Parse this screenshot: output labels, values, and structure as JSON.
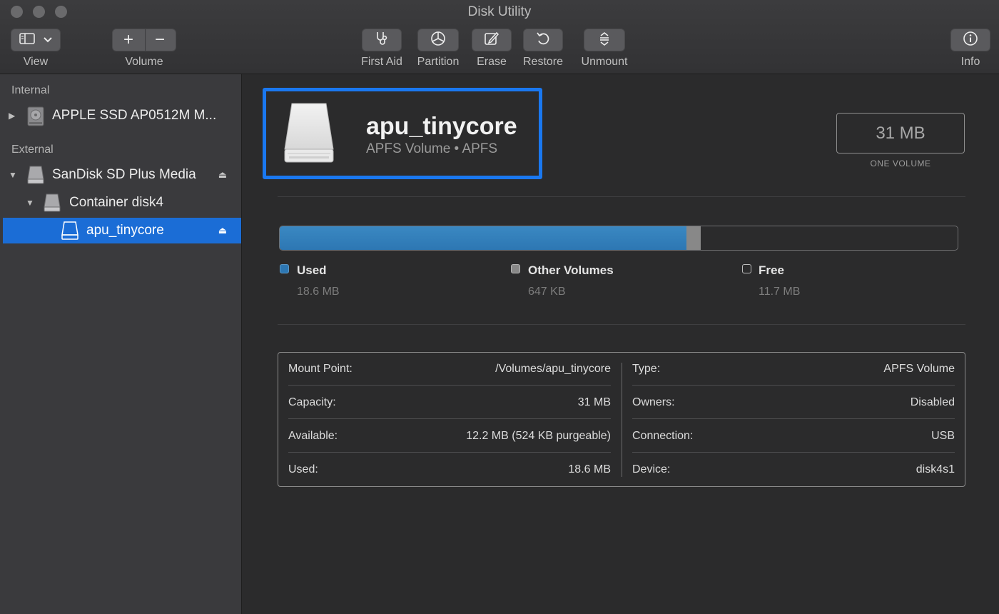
{
  "window": {
    "title": "Disk Utility"
  },
  "toolbar": {
    "view_label": "View",
    "volume_label": "Volume",
    "first_aid_label": "First Aid",
    "partition_label": "Partition",
    "erase_label": "Erase",
    "restore_label": "Restore",
    "unmount_label": "Unmount",
    "info_label": "Info",
    "add_symbol": "+",
    "remove_symbol": "−"
  },
  "sidebar": {
    "internal_header": "Internal",
    "external_header": "External",
    "items": [
      {
        "label": "APPLE SSD AP0512M M...",
        "icon": "internal-disk-icon",
        "expanded": false
      },
      {
        "label": "SanDisk SD Plus Media",
        "icon": "external-disk-icon",
        "expanded": true
      },
      {
        "label": "Container disk4",
        "icon": "container-disk-icon",
        "expanded": true
      },
      {
        "label": "apu_tinycore",
        "icon": "volume-icon",
        "selected": true
      }
    ]
  },
  "volume": {
    "name": "apu_tinycore",
    "subtitle": "APFS Volume • APFS",
    "capacity": "31 MB",
    "capacity_caption": "ONE VOLUME"
  },
  "usage": {
    "used_fraction": 0.6,
    "other_fraction": 0.021,
    "legend": [
      {
        "name": "Used",
        "value": "18.6 MB",
        "color": "#2d77b3"
      },
      {
        "name": "Other Volumes",
        "value": "647 KB",
        "color": "#888888"
      },
      {
        "name": "Free",
        "value": "11.7 MB",
        "color": "#2b2b2c"
      }
    ]
  },
  "info": {
    "left": [
      {
        "key": "Mount Point:",
        "value": "/Volumes/apu_tinycore"
      },
      {
        "key": "Capacity:",
        "value": "31 MB"
      },
      {
        "key": "Available:",
        "value": "12.2 MB (524 KB purgeable)"
      },
      {
        "key": "Used:",
        "value": "18.6 MB"
      }
    ],
    "right": [
      {
        "key": "Type:",
        "value": "APFS Volume"
      },
      {
        "key": "Owners:",
        "value": "Disabled"
      },
      {
        "key": "Connection:",
        "value": "USB"
      },
      {
        "key": "Device:",
        "value": "disk4s1"
      }
    ]
  },
  "colors": {
    "accent": "#1a78f0",
    "selection": "#1b6dd6"
  }
}
